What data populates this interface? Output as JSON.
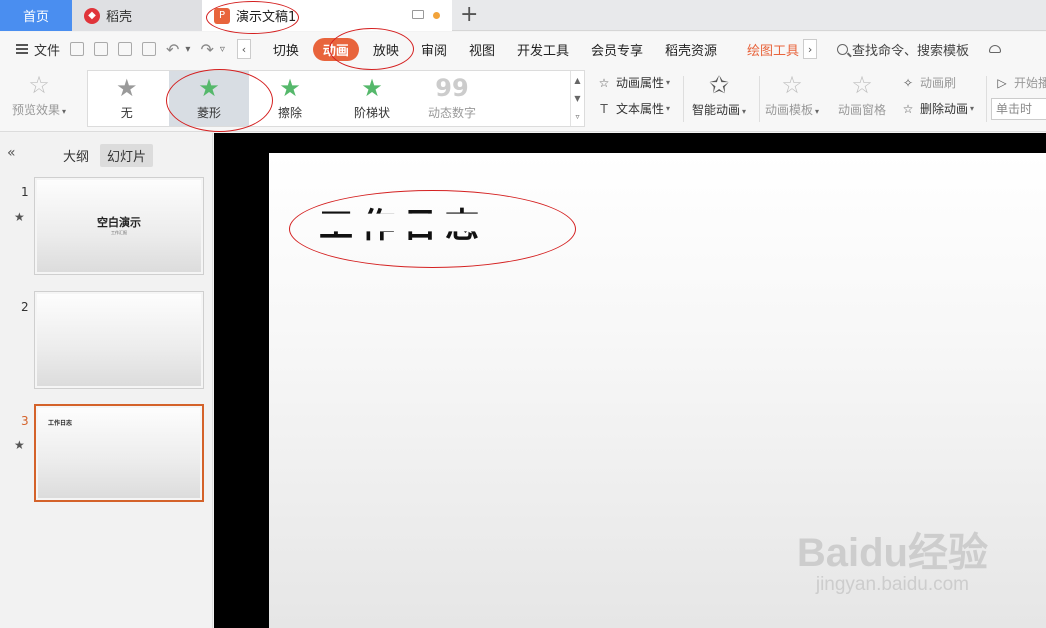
{
  "tabs": {
    "home": "首页",
    "daoke": "稻壳",
    "doc": "演示文稿1"
  },
  "menu": {
    "file": "文件",
    "items": [
      "切换",
      "动画",
      "放映",
      "审阅",
      "视图",
      "开发工具",
      "会员专享",
      "稻壳资源"
    ],
    "drawing_tools": "绘图工具",
    "search": "查找命令、搜索模板"
  },
  "ribbon": {
    "preview": "预览效果",
    "gallery": [
      "无",
      "菱形",
      "擦除",
      "阶梯状",
      "动态数字"
    ],
    "anim_props": "动画属性",
    "text_props": "文本属性",
    "smart_anim": "智能动画",
    "anim_template": "动画模板",
    "anim_pane": "动画窗格",
    "anim_brush": "动画刷",
    "delete_anim": "删除动画",
    "start_play": "开始播",
    "on_click": "单击时"
  },
  "left_panel": {
    "outline": "大纲",
    "slides": "幻灯片",
    "thumbs": [
      {
        "num": "1",
        "title": "空白演示",
        "subtitle": "工作汇报"
      },
      {
        "num": "2"
      },
      {
        "num": "3",
        "title": "工作日志"
      }
    ]
  },
  "slide": {
    "title": "工作日志"
  },
  "watermark": {
    "main": "Baidu经验",
    "sub": "jingyan.baidu.com"
  },
  "colors": {
    "accent": "#e8643c",
    "home_tab": "#4a8ef0",
    "annotation": "#d42020"
  }
}
